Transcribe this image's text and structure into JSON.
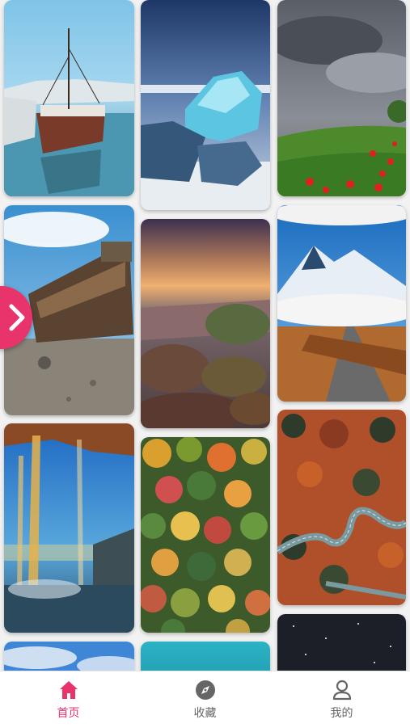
{
  "tabs": [
    {
      "label": "首页",
      "icon": "home-icon",
      "active": true
    },
    {
      "label": "收藏",
      "icon": "compass-icon",
      "active": false
    },
    {
      "label": "我的",
      "icon": "user-icon",
      "active": false
    }
  ],
  "colors": {
    "accent": "#e8336b",
    "inactive": "#666666",
    "background": "#f2f2f2"
  },
  "wallpapers": [
    {
      "subject": "boats-harbor"
    },
    {
      "subject": "iceberg"
    },
    {
      "subject": "storm-field-poppies"
    },
    {
      "subject": "shipwreck-beach"
    },
    {
      "subject": "sunset-rocky-coast"
    },
    {
      "subject": "snow-mountain-road"
    },
    {
      "subject": "waterfall-cave"
    },
    {
      "subject": "autumn-forest-aerial"
    },
    {
      "subject": "winding-road-forest"
    }
  ],
  "side_button_icon": "chevron-right-icon"
}
